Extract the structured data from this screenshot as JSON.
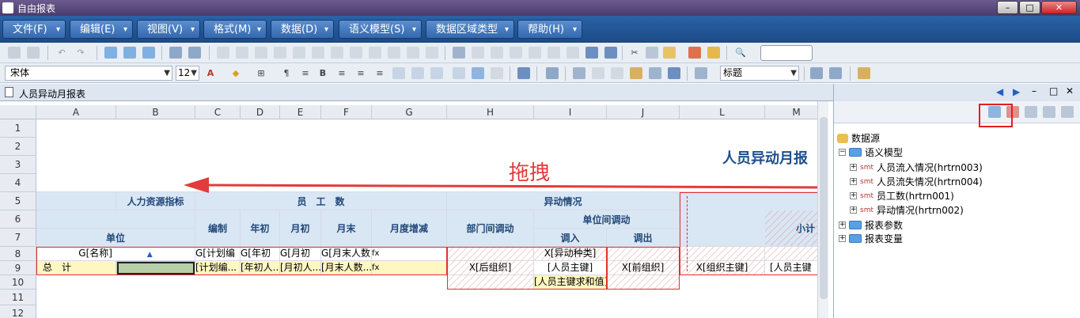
{
  "window": {
    "title": "自由报表"
  },
  "menu": [
    "文件(F)",
    "编辑(E)",
    "视图(V)",
    "格式(M)",
    "数据(D)",
    "语义模型(S)",
    "数据区域类型",
    "帮助(H)"
  ],
  "format_bar": {
    "font": "宋体",
    "size": "12",
    "style": "标题"
  },
  "document": {
    "tab_label": "人员异动月报表"
  },
  "columns": [
    "A",
    "B",
    "C",
    "D",
    "E",
    "F",
    "G",
    "H",
    "I",
    "J",
    "L",
    "M"
  ],
  "rows": [
    "1",
    "2",
    "3",
    "4",
    "5",
    "6",
    "7",
    "8",
    "9",
    "10",
    "11",
    "12"
  ],
  "sheet": {
    "title": "人员异动月报",
    "drag_hint": "拖拽",
    "hr_indicator": "人力资源指标",
    "employee_count": "员　工　数",
    "movement": "异动情况",
    "unit": "单位",
    "headcount_plan": "编制",
    "year_start": "年初",
    "month_start": "月初",
    "month_end": "月末",
    "monthly_change": "月度增减",
    "inter_dept": "部门间调动",
    "inter_unit": "单位间调动",
    "transfer_in": "调入",
    "transfer_out": "调出",
    "subtotal": "小计",
    "r8": {
      "name": "G[名称]",
      "plan": "G[计划编",
      "year": "G[年初",
      "month": "G[月初",
      "month_end": "G[月末人数]",
      "fx": "fx",
      "movement_type": "X[异动种类]"
    },
    "r9": {
      "total": "总　计",
      "plan": "[计划编...",
      "year": "[年初人...",
      "month": "[月初人...",
      "month_end": "[月末人数...",
      "fx": "fx",
      "post_org": "X[后组织]",
      "person_key": "[人员主键]",
      "pre_org": "X[前组织]",
      "org_key": "X[组织主键]",
      "person_key2": "[人员主键"
    },
    "r10": {
      "sum_key": "[人员主键求和值]"
    }
  },
  "panel": {
    "root": "数据源",
    "semantic": "语义模型",
    "smt_tag": "smt",
    "items": [
      "人员流入情况(hrtrn003)",
      "人员流失情况(hrtrn004)",
      "员工数(hrtrn001)",
      "异动情况(hrtrn002)"
    ],
    "params": "报表参数",
    "vars": "报表变量"
  }
}
